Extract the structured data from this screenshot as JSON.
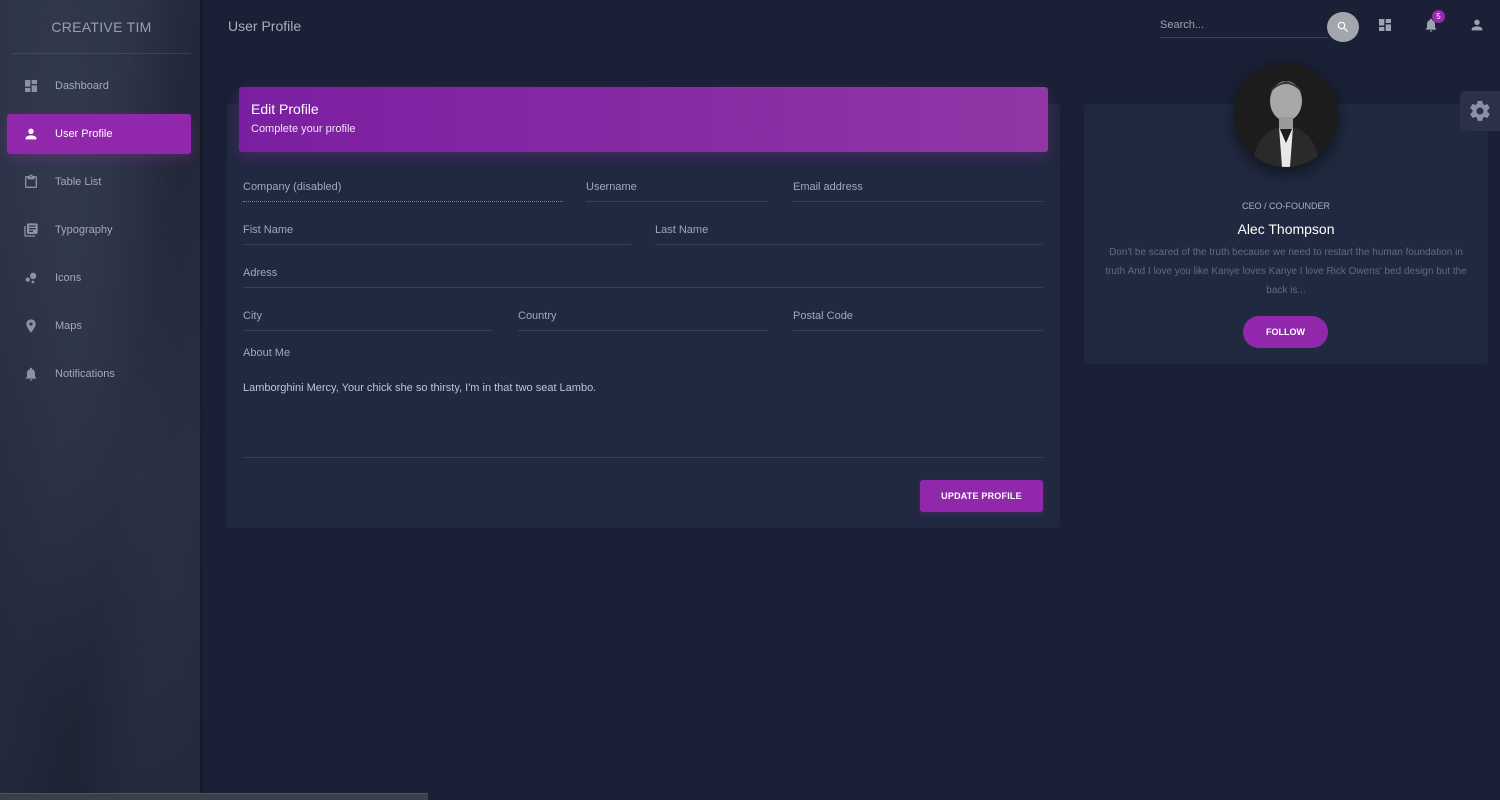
{
  "brand": "CREATIVE TIM",
  "sidebar": {
    "items": [
      {
        "label": "Dashboard",
        "icon": "dashboard-icon"
      },
      {
        "label": "User Profile",
        "icon": "person-icon"
      },
      {
        "label": "Table List",
        "icon": "clipboard-icon"
      },
      {
        "label": "Typography",
        "icon": "library-books-icon"
      },
      {
        "label": "Icons",
        "icon": "bubble-chart-icon"
      },
      {
        "label": "Maps",
        "icon": "location-pin-icon"
      },
      {
        "label": "Notifications",
        "icon": "bell-icon"
      }
    ],
    "active_index": 1
  },
  "topbar": {
    "title": "User Profile",
    "search_placeholder": "Search...",
    "notification_count": "5"
  },
  "edit_profile": {
    "title": "Edit Profile",
    "subtitle": "Complete your profile",
    "fields": {
      "company": "Company (disabled)",
      "username": "Username",
      "email": "Email address",
      "first_name": "Fist Name",
      "last_name": "Last Name",
      "address": "Adress",
      "city": "City",
      "country": "Country",
      "postal_code": "Postal Code"
    },
    "about_label": "About Me",
    "about_text": "Lamborghini Mercy, Your chick she so thirsty, I'm in that two seat Lambo.",
    "update_label": "UPDATE PROFILE"
  },
  "profile": {
    "role": "CEO / CO-FOUNDER",
    "name": "Alec Thompson",
    "bio": "Don't be scared of the truth because we need to restart the human foundation in truth And I love you like Kanye loves Kanye I love Rick Owens' bed design but the back is...",
    "follow_label": "FOLLOW"
  },
  "colors": {
    "accent": "#9c27b0",
    "background": "#1a2035",
    "card": "#202940"
  }
}
